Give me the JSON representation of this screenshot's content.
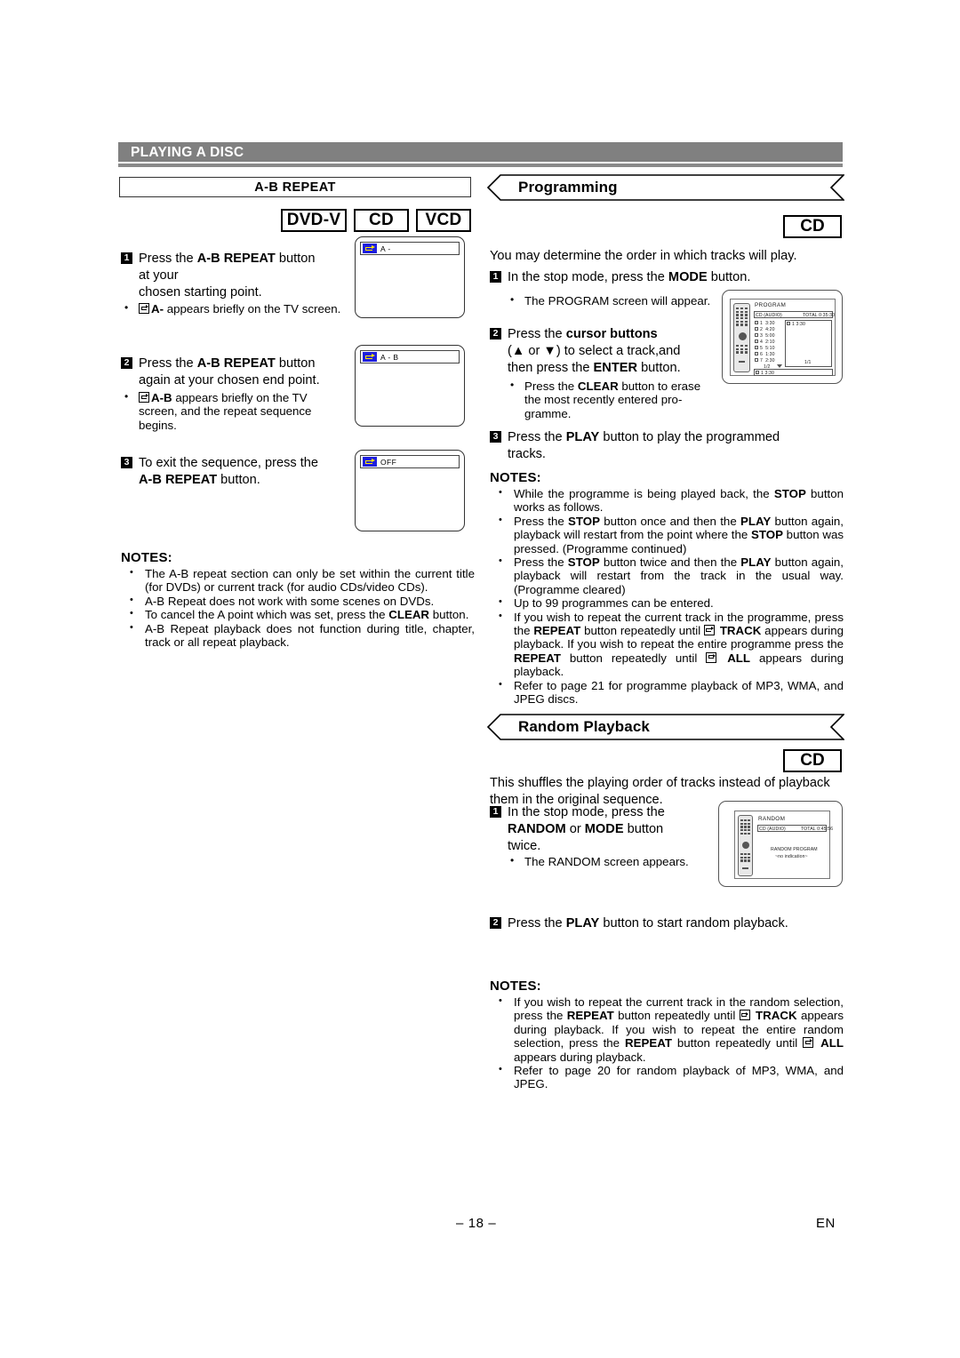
{
  "header": {
    "section_title": "PLAYING A DISC"
  },
  "left_column": {
    "title_box": "A-B REPEAT",
    "badges": [
      "DVD-V",
      "CD",
      "VCD"
    ],
    "steps": [
      {
        "num": "1",
        "line1_pre": "Press the ",
        "line1_bold": "A-B REPEAT",
        "line1_post": " button",
        "line2": "at your",
        "line3": "chosen starting point."
      },
      {
        "num": "2",
        "line1_pre": "Press the ",
        "line1_bold": "A-B REPEAT",
        "line1_post": " button",
        "line2": "again at your chosen end point."
      },
      {
        "num": "3",
        "line1": "To exit the sequence, press the",
        "line2_bold": "A-B REPEAT",
        "line2_post": " button."
      }
    ],
    "bullets": [
      {
        "icon": "repeat-icon",
        "bold": "A-",
        "rest": " appears briefly on the TV screen."
      },
      {
        "icon": "repeat-icon",
        "bold": "A-B",
        "rest": " appears briefly on the TV screen, and the repeat sequence begins."
      }
    ],
    "tv_screens": [
      {
        "icon": "repeat-icon",
        "label": "A -"
      },
      {
        "icon": "repeat-icon",
        "label": "A - B"
      },
      {
        "icon": "repeat-icon",
        "label": "OFF"
      }
    ],
    "notes_title": "NOTES:",
    "notes": [
      "The A-B repeat section can only be set within the current title (for DVDs) or current track (for audio CDs/video CDs).",
      "A-B Repeat does not work with some scenes on DVDs.",
      "To cancel the A point which was set, press the CLEAR button.",
      "A-B Repeat playback does not function during title, chapter, track or all repeat playback."
    ]
  },
  "programming": {
    "heading": "Programming",
    "badge": "CD",
    "intro": "You may determine the order in which tracks will play.",
    "steps": [
      {
        "num": "1",
        "pre": "In the stop mode, press the ",
        "bold": "MODE",
        "post": " button."
      },
      {
        "num": "2",
        "pre": "Press the ",
        "bold": "cursor buttons",
        "line2": "(▲ or ▼) to select a track,and",
        "line3_pre": "then press the ",
        "line3_bold": "ENTER",
        "line3_post": " button."
      },
      {
        "num": "3",
        "pre": "Press the ",
        "bold": "PLAY",
        "post": " button to play the programmed",
        "line2": "tracks."
      }
    ],
    "bullets": [
      "The PROGRAM screen will appear.",
      "Press the CLEAR button to erase the most recently entered programme."
    ],
    "osd": {
      "title": "PROGRAM",
      "disc_type": "CD (AUDIO)",
      "total": "TOTAL 0:35:30",
      "tracks": [
        {
          "no": "1",
          "time": "3:30"
        },
        {
          "no": "2",
          "time": "4:20"
        },
        {
          "no": "3",
          "time": "5:00"
        },
        {
          "no": "4",
          "time": "2:10"
        },
        {
          "no": "5",
          "time": "5:10"
        },
        {
          "no": "6",
          "time": "1:30"
        },
        {
          "no": "7",
          "time": "2:30"
        }
      ],
      "page_left": "1/2",
      "program_entry": "1   3:30",
      "page_right": "1/1",
      "status_entry": "1   3:30"
    },
    "notes_title": "NOTES:",
    "notes": [
      "While the programme is being played back, the STOP button works as follows.",
      "Press the STOP button once and then the PLAY button again, playback will restart from the point where the STOP button was pressed. (Programme continued)",
      "Press the STOP button twice and then the PLAY button again, playback will restart from the track in the usual way. (Programme cleared)",
      "Up to 99 programmes can be entered.",
      "If you wish to repeat the current track in the programme, press the REPEAT button repeatedly until [repeat] TRACK appears during playback. If you wish to repeat the entire programme press the REPEAT button repeatedly until [repeat] ALL appears during playback.",
      "Refer to page 21 for programme playback of MP3, WMA, and JPEG discs."
    ]
  },
  "random": {
    "heading": "Random Playback",
    "badge": "CD",
    "intro": "This shuffles the playing order of tracks instead of playback them in the original sequence.",
    "steps": [
      {
        "num": "1",
        "line1": "In the stop mode, press the",
        "line2_bold_a": "RANDOM",
        "line2_mid": " or ",
        "line2_bold_b": "MODE",
        "line2_post": " button",
        "line3": "twice."
      },
      {
        "num": "2",
        "pre": "Press the ",
        "bold": "PLAY",
        "post": " button to start random playback."
      }
    ],
    "bullets": [
      "The RANDOM screen appears."
    ],
    "osd": {
      "title": "RANDOM",
      "disc_type": "CD (AUDIO)",
      "total": "TOTAL 0:45:56",
      "center_line1": "RANDOM PROGRAM",
      "center_line2": "~no indication~"
    },
    "notes_title": "NOTES:",
    "notes": [
      "If you wish to repeat the current track in the random selection, press the REPEAT button repeatedly until [repeat] TRACK appears during playback. If you wish to repeat the entire random selection, press the REPEAT button repeatedly until [repeat] ALL appears during playback.",
      "Refer to page 20 for random playback of MP3, WMA, and JPEG."
    ]
  },
  "footer": {
    "page_number": "– 18 –",
    "language": "EN"
  },
  "colors": {
    "header_bar": "#808080",
    "osd_icon_bg": "#1f1fdd",
    "osd_icon_fg": "#ffe800"
  }
}
